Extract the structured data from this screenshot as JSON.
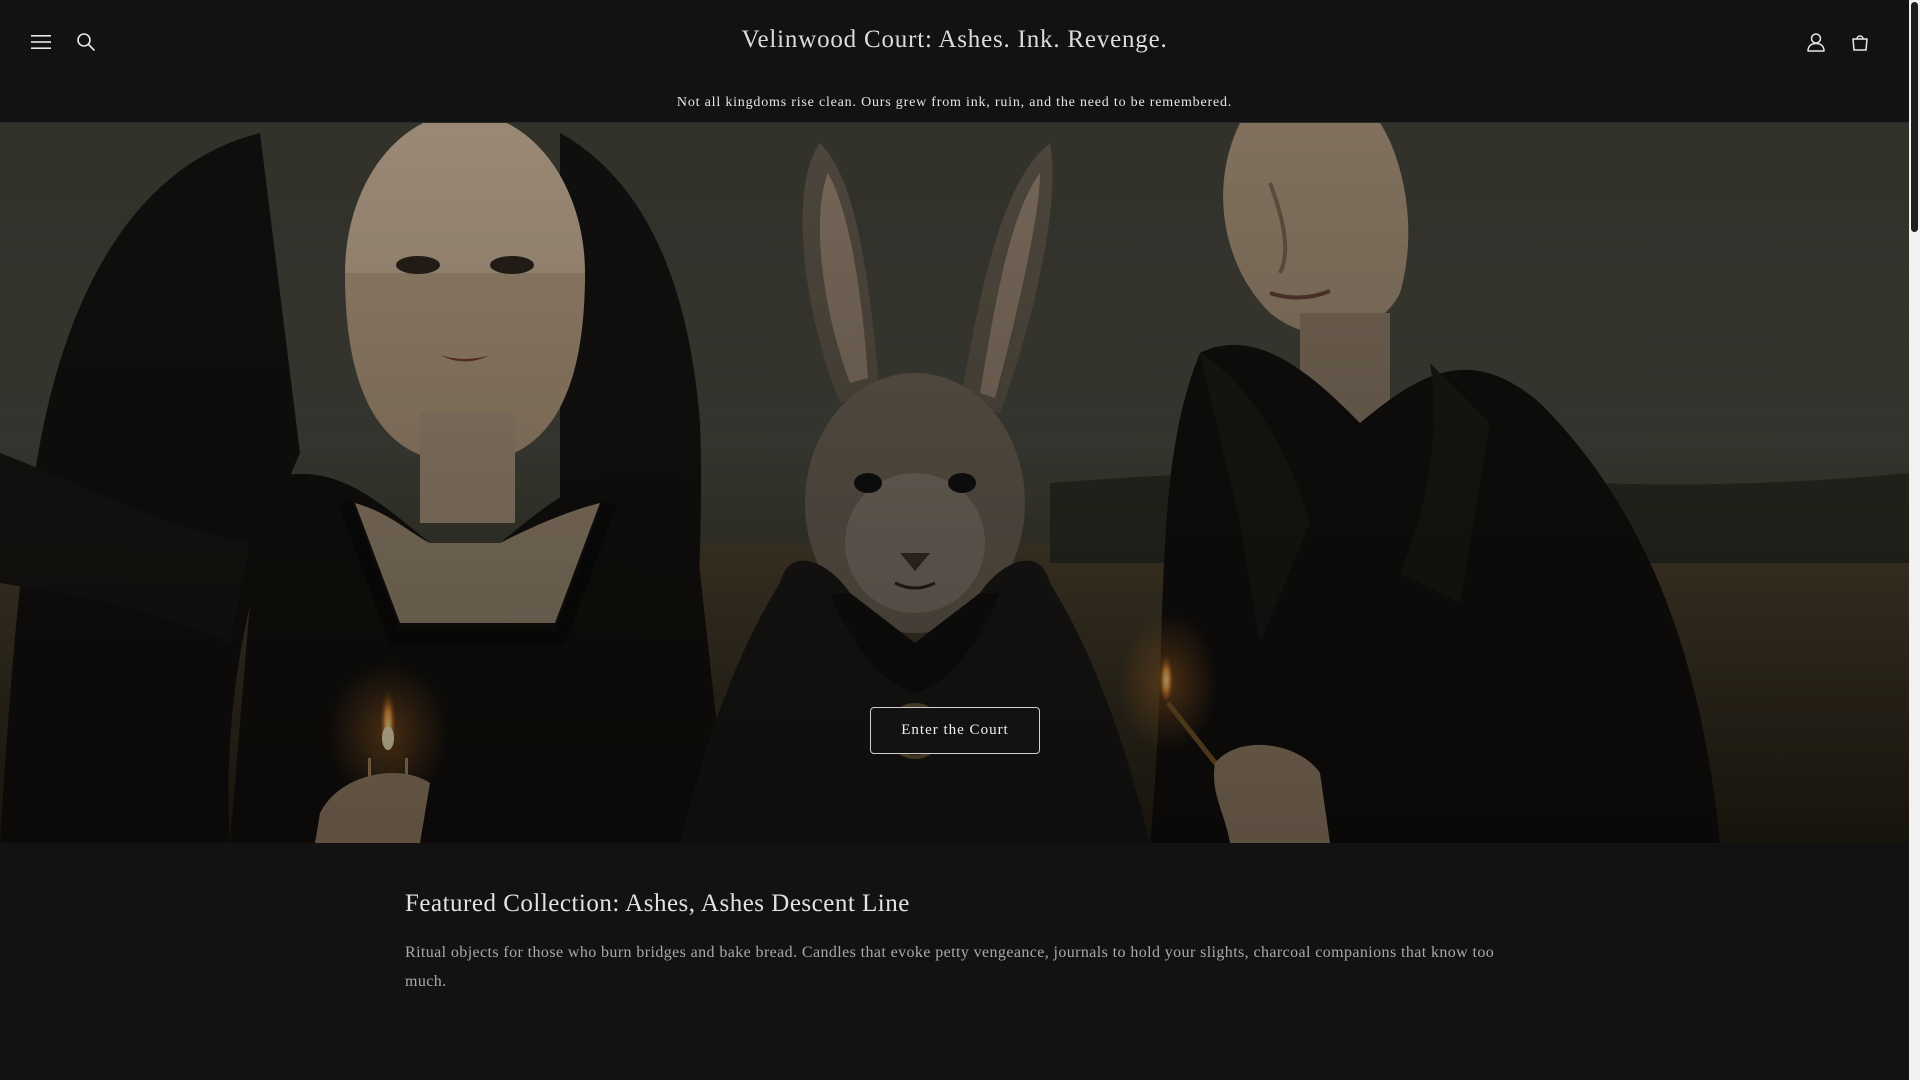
{
  "header": {
    "title": "Velinwood Court: Ashes. Ink. Revenge.",
    "icons": {
      "menu": "hamburger-menu-icon",
      "search": "search-icon",
      "account": "account-icon",
      "cart": "cart-icon"
    }
  },
  "announcement": {
    "text": "Not all kingdoms rise clean. Ours grew from ink, ruin, and the need to be remembered."
  },
  "hero": {
    "cta_label": "Enter the Court"
  },
  "featured": {
    "heading": "Featured Collection: Ashes, Ashes Descent Line",
    "description": "Ritual objects for those who burn bridges and bake bread. Candles that evoke petty vengeance, journals to hold your slights, charcoal companions that know too much."
  },
  "colors": {
    "background": "#121212",
    "text": "#e2e2e2",
    "muted_text": "#a9a9a9",
    "button_border": "#cfcfcf"
  }
}
